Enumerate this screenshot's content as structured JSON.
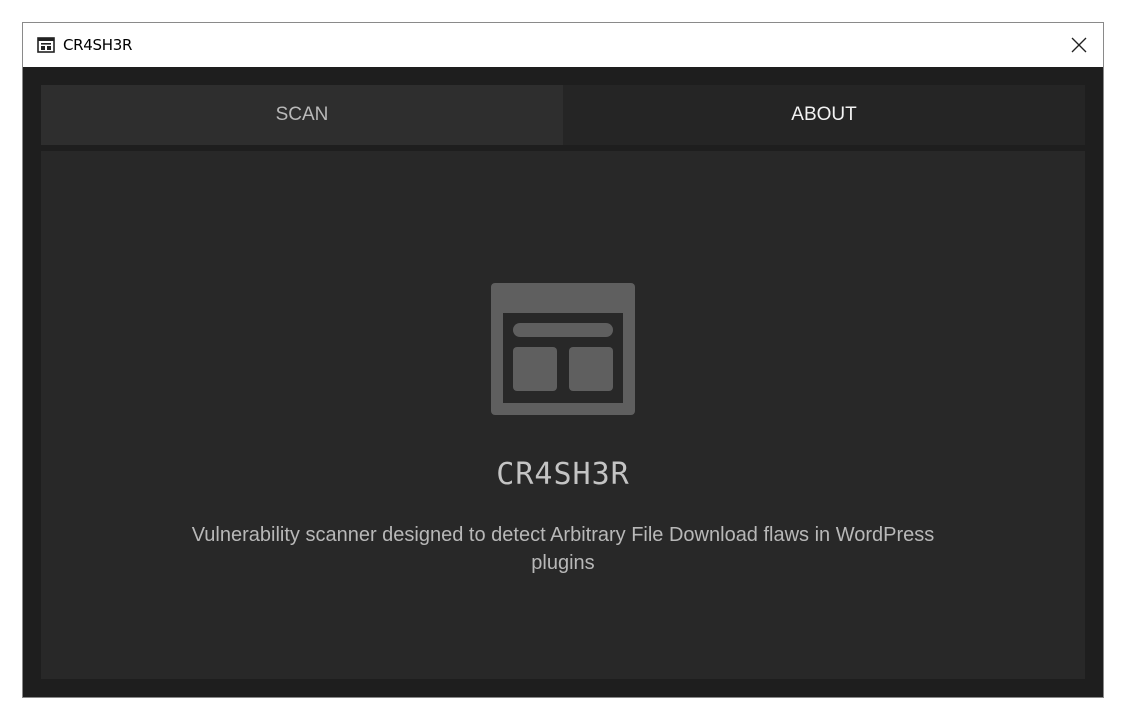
{
  "window": {
    "title": "CR4SH3R",
    "title_icon": "window-layout-icon",
    "close_icon": "close-icon"
  },
  "tabs": [
    {
      "label": "SCAN",
      "active": false
    },
    {
      "label": "ABOUT",
      "active": true
    }
  ],
  "about": {
    "logo_icon": "window-layout-icon",
    "app_name": "CR4SH3R",
    "description": "Vulnerability scanner designed to detect Arbitrary File Download flaws in WordPress plugins"
  },
  "colors": {
    "background": "#1e1e1e",
    "panel": "#282828",
    "tab_inactive": "#2e2e2e",
    "tab_active": "#252525",
    "logo": "#5f5f5f"
  }
}
